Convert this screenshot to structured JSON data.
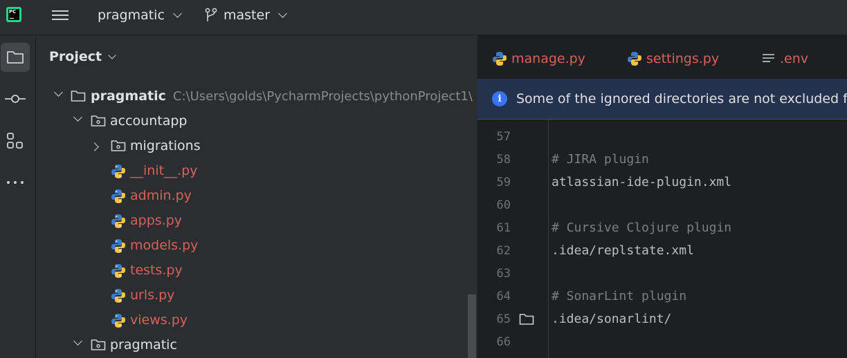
{
  "colors": {
    "accent": "#3574f0",
    "modified_file": "#d5635a",
    "background": "#1e1f22",
    "panel": "#2b2d30",
    "banner": "#25324d"
  },
  "toolbar": {
    "app_icon": "pycharm-logo",
    "app_logo_text": "PC",
    "project_name": "pragmatic",
    "branch": "master"
  },
  "toolstrip": {
    "items": [
      {
        "icon": "folder-icon",
        "active": true
      },
      {
        "icon": "commit-icon",
        "active": false
      },
      {
        "icon": "structure-icon",
        "active": false
      },
      {
        "icon": "more-icon",
        "active": false
      }
    ]
  },
  "project_panel": {
    "title": "Project",
    "tree": [
      {
        "label": "pragmatic",
        "path": "C:\\Users\\golds\\PycharmProjects\\pythonProject1\\",
        "type": "root",
        "expanded": true
      },
      {
        "label": "accountapp",
        "type": "package",
        "expanded": true
      },
      {
        "label": "migrations",
        "type": "package",
        "expanded": false
      },
      {
        "label": "__init__.py",
        "type": "py"
      },
      {
        "label": "admin.py",
        "type": "py"
      },
      {
        "label": "apps.py",
        "type": "py"
      },
      {
        "label": "models.py",
        "type": "py"
      },
      {
        "label": "tests.py",
        "type": "py"
      },
      {
        "label": "urls.py",
        "type": "py"
      },
      {
        "label": "views.py",
        "type": "py"
      },
      {
        "label": "pragmatic",
        "type": "package",
        "expanded": true
      }
    ]
  },
  "editor": {
    "tabs": [
      {
        "label": "manage.py",
        "icon": "python-icon"
      },
      {
        "label": "settings.py",
        "icon": "python-icon"
      },
      {
        "label": ".env",
        "icon": "text-file-icon"
      }
    ],
    "banner": "Some of the ignored directories are not excluded fro",
    "lines": [
      {
        "num": "57",
        "text": "",
        "kind": "plain"
      },
      {
        "num": "58",
        "text": "# JIRA plugin",
        "kind": "comment"
      },
      {
        "num": "59",
        "text": "atlassian-ide-plugin.xml",
        "kind": "plain"
      },
      {
        "num": "60",
        "text": "",
        "kind": "plain"
      },
      {
        "num": "61",
        "text": "# Cursive Clojure plugin",
        "kind": "comment"
      },
      {
        "num": "62",
        "text": ".idea/replstate.xml",
        "kind": "plain"
      },
      {
        "num": "63",
        "text": "",
        "kind": "plain"
      },
      {
        "num": "64",
        "text": "# SonarLint plugin",
        "kind": "comment"
      },
      {
        "num": "65",
        "text": ".idea/sonarlint/",
        "kind": "plain",
        "gutter_icon": "folder-icon"
      },
      {
        "num": "66",
        "text": "",
        "kind": "plain"
      }
    ]
  }
}
